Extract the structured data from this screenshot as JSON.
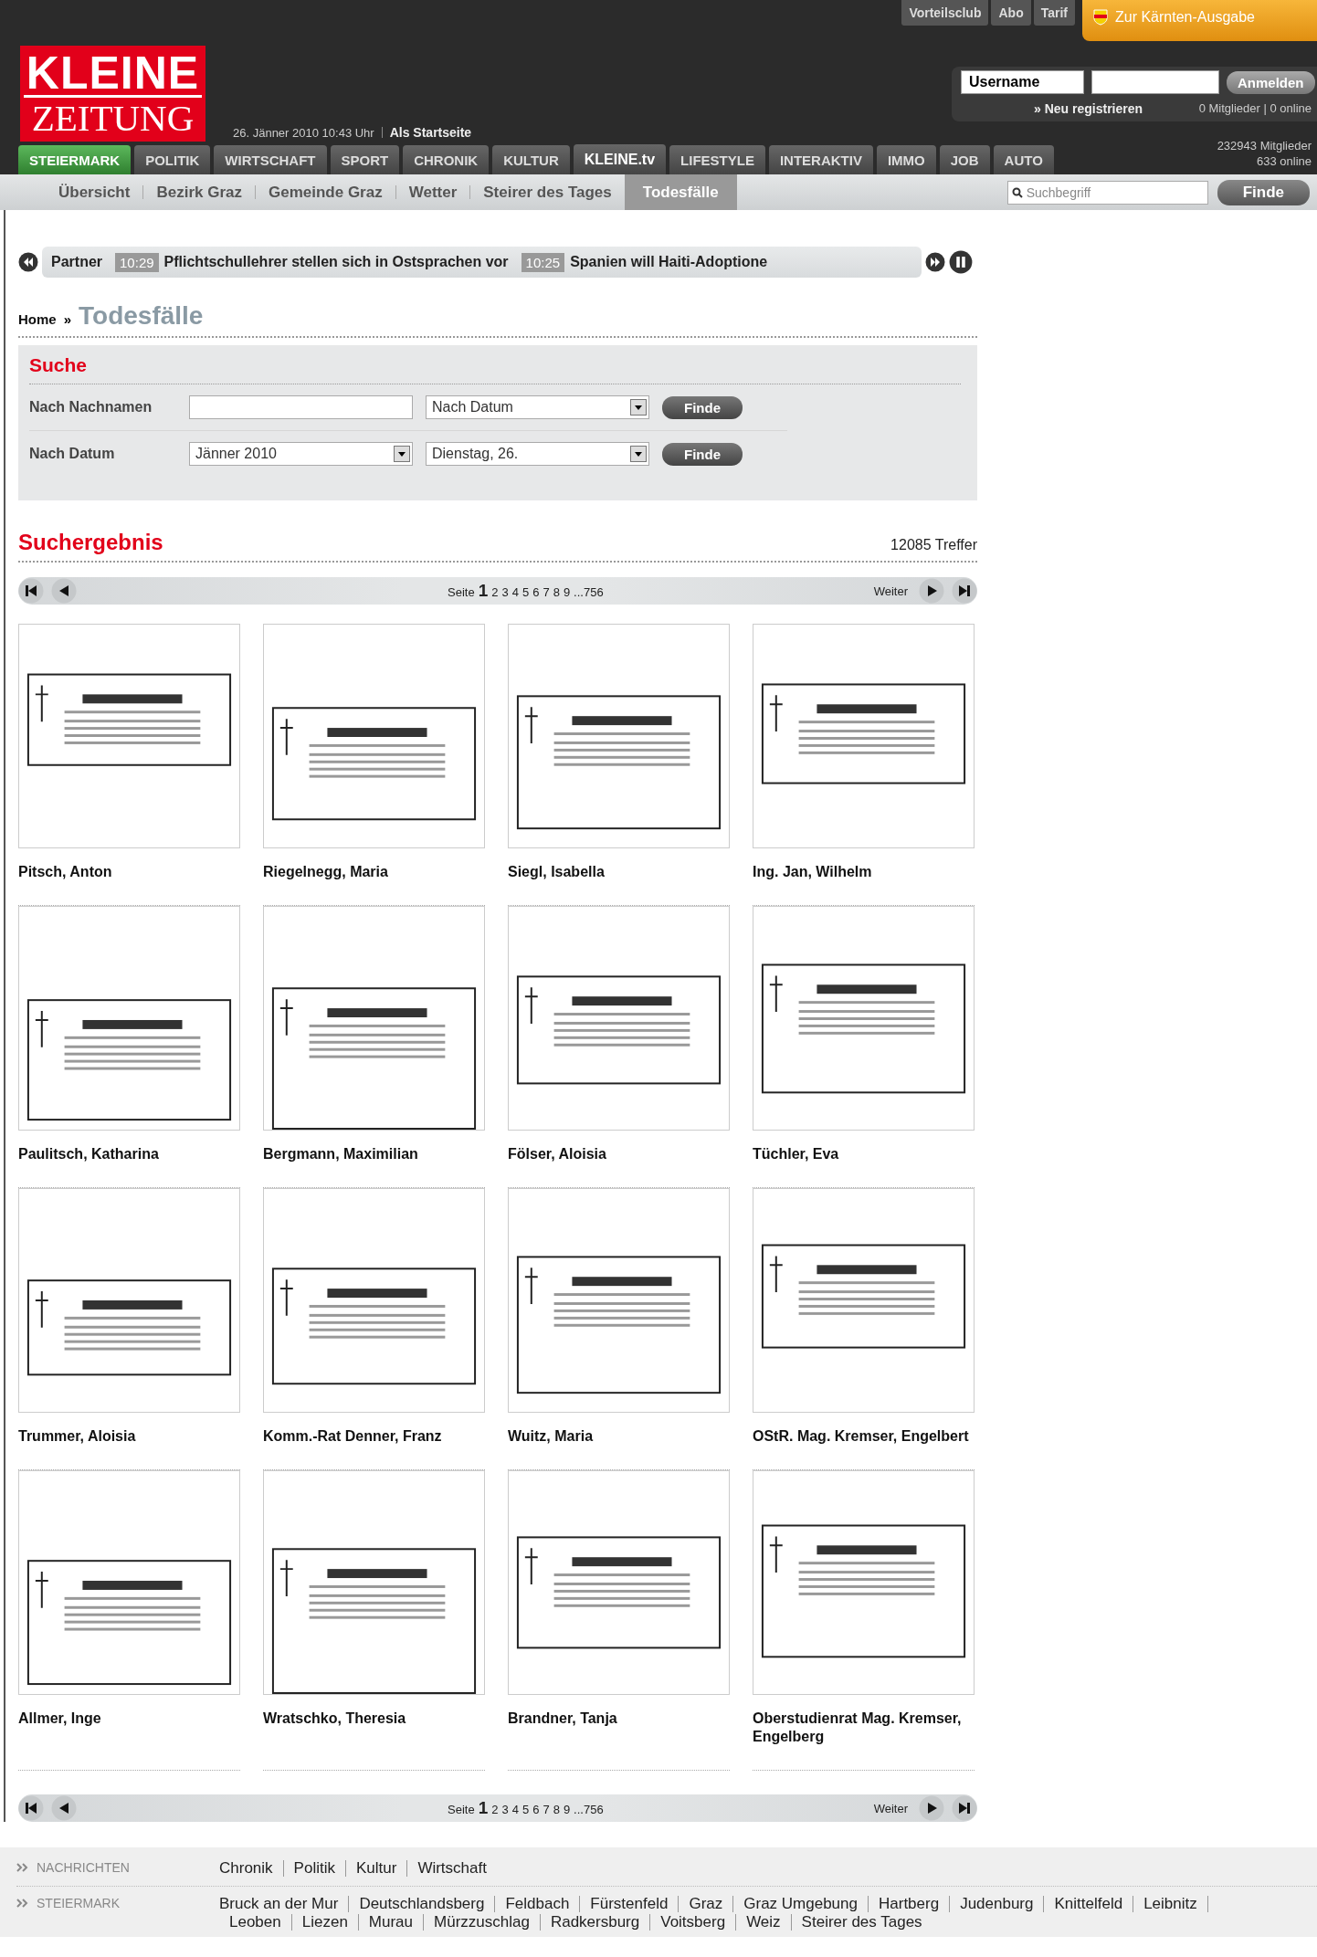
{
  "header": {
    "logo_lines": [
      "KLEINE",
      "ZEITUNG"
    ],
    "date": "26. Jänner 2010 10:43 Uhr",
    "start_link": "Als Startseite",
    "top_links": [
      "Vorteilsclub",
      "Abo",
      "Tarif"
    ],
    "edition_button": "Zur Kärnten-Ausgabe",
    "login": {
      "username": "Username",
      "button": "Anmelden",
      "register": "» Neu registrieren",
      "status": "0 Mitglieder | 0 online"
    },
    "members": "232943 Mitglieder",
    "online": "633 online"
  },
  "nav": [
    {
      "label": "STEIERMARK",
      "selected": true,
      "emphasized": false
    },
    {
      "label": "POLITIK",
      "selected": false,
      "emphasized": false
    },
    {
      "label": "WIRTSCHAFT",
      "selected": false,
      "emphasized": false
    },
    {
      "label": "SPORT",
      "selected": false,
      "emphasized": false
    },
    {
      "label": "CHRONIK",
      "selected": false,
      "emphasized": false
    },
    {
      "label": "KULTUR",
      "selected": false,
      "emphasized": false
    },
    {
      "label": "KLEINE.tv",
      "selected": false,
      "emphasized": true
    },
    {
      "label": "LIFESTYLE",
      "selected": false,
      "emphasized": false
    },
    {
      "label": "INTERAKTIV",
      "selected": false,
      "emphasized": false
    },
    {
      "label": "IMMO",
      "selected": false,
      "emphasized": false
    },
    {
      "label": "JOB",
      "selected": false,
      "emphasized": false
    },
    {
      "label": "AUTO",
      "selected": false,
      "emphasized": false
    }
  ],
  "subnav": {
    "items": [
      {
        "label": "Übersicht",
        "selected": false
      },
      {
        "label": "Bezirk Graz",
        "selected": false
      },
      {
        "label": "Gemeinde Graz",
        "selected": false
      },
      {
        "label": "Wetter",
        "selected": false
      },
      {
        "label": "Steirer des Tages",
        "selected": false
      },
      {
        "label": "Todesfälle",
        "selected": true
      }
    ],
    "search": {
      "placeholder": "Suchbegriff",
      "button": "Finde"
    }
  },
  "ticker": {
    "label": "Partner",
    "items": [
      {
        "time": "10:29",
        "text": "Pflichtschullehrer stellen sich in Ostsprachen vor"
      },
      {
        "time": "10:25",
        "text": "Spanien will Haiti-Adoptione"
      }
    ]
  },
  "breadcrumb": {
    "home": "Home",
    "separator": "»",
    "current": "Todesfälle"
  },
  "search_form": {
    "title": "Suche",
    "rows": [
      {
        "kind": "name",
        "label": "Nach Nachnamen",
        "selects": [
          "Nach Datum"
        ],
        "button": "Finde"
      },
      {
        "kind": "date",
        "label": "Nach Datum",
        "selects": [
          "Jänner 2010",
          "Dienstag, 26."
        ],
        "button": "Finde"
      }
    ]
  },
  "results": {
    "title": "Suchergebnis",
    "count": "12085 Treffer"
  },
  "pagination": [
    {
      "label": "Seite",
      "pages": [
        {
          "label": "1",
          "selected": true
        },
        {
          "label": "2",
          "selected": false
        },
        {
          "label": "3",
          "selected": false
        },
        {
          "label": "4",
          "selected": false
        },
        {
          "label": "5",
          "selected": false
        },
        {
          "label": "6",
          "selected": false
        },
        {
          "label": "7",
          "selected": false
        },
        {
          "label": "8",
          "selected": false
        },
        {
          "label": "9",
          "selected": false
        },
        {
          "label": "...756",
          "selected": false
        }
      ],
      "next": "Weiter"
    },
    {
      "label": "Seite",
      "pages": [
        {
          "label": "1",
          "selected": true
        },
        {
          "label": "2",
          "selected": false
        },
        {
          "label": "3",
          "selected": false
        },
        {
          "label": "4",
          "selected": false
        },
        {
          "label": "5",
          "selected": false
        },
        {
          "label": "6",
          "selected": false
        },
        {
          "label": "7",
          "selected": false
        },
        {
          "label": "8",
          "selected": false
        },
        {
          "label": "9",
          "selected": false
        },
        {
          "label": "...756",
          "selected": false
        }
      ],
      "next": "Weiter"
    }
  ],
  "obituaries": [
    {
      "name": "Pitsch, Anton"
    },
    {
      "name": "Riegelnegg, Maria"
    },
    {
      "name": "Siegl, Isabella"
    },
    {
      "name": "Ing. Jan, Wilhelm"
    },
    {
      "name": "Paulitsch, Katharina"
    },
    {
      "name": "Bergmann, Maximilian"
    },
    {
      "name": "Fölser, Aloisia"
    },
    {
      "name": "Tüchler, Eva"
    },
    {
      "name": "Trummer, Aloisia"
    },
    {
      "name": "Komm.-Rat Denner, Franz"
    },
    {
      "name": "Wuitz, Maria"
    },
    {
      "name": "OStR. Mag. Kremser, Engelbert"
    },
    {
      "name": "Allmer, Inge"
    },
    {
      "name": "Wratschko, Theresia"
    },
    {
      "name": "Brandner, Tanja"
    },
    {
      "name": "Oberstudienrat Mag. Kremser, Engelberg"
    }
  ],
  "footer": [
    {
      "title": "NACHRICHTEN",
      "links": [
        "Chronik",
        "Politik",
        "Kultur",
        "Wirtschaft"
      ]
    },
    {
      "title": "STEIERMARK",
      "links": [
        "Bruck an der Mur",
        "Deutschlandsberg",
        "Feldbach",
        "Fürstenfeld",
        "Graz",
        "Graz Umgebung",
        "Hartberg",
        "Judenburg",
        "Knittelfeld",
        "Leibnitz",
        "Leoben",
        "Liezen",
        "Murau",
        "Mürzzuschlag",
        "Radkersburg",
        "Voitsberg",
        "Weiz",
        "Steirer des Tages"
      ]
    }
  ]
}
